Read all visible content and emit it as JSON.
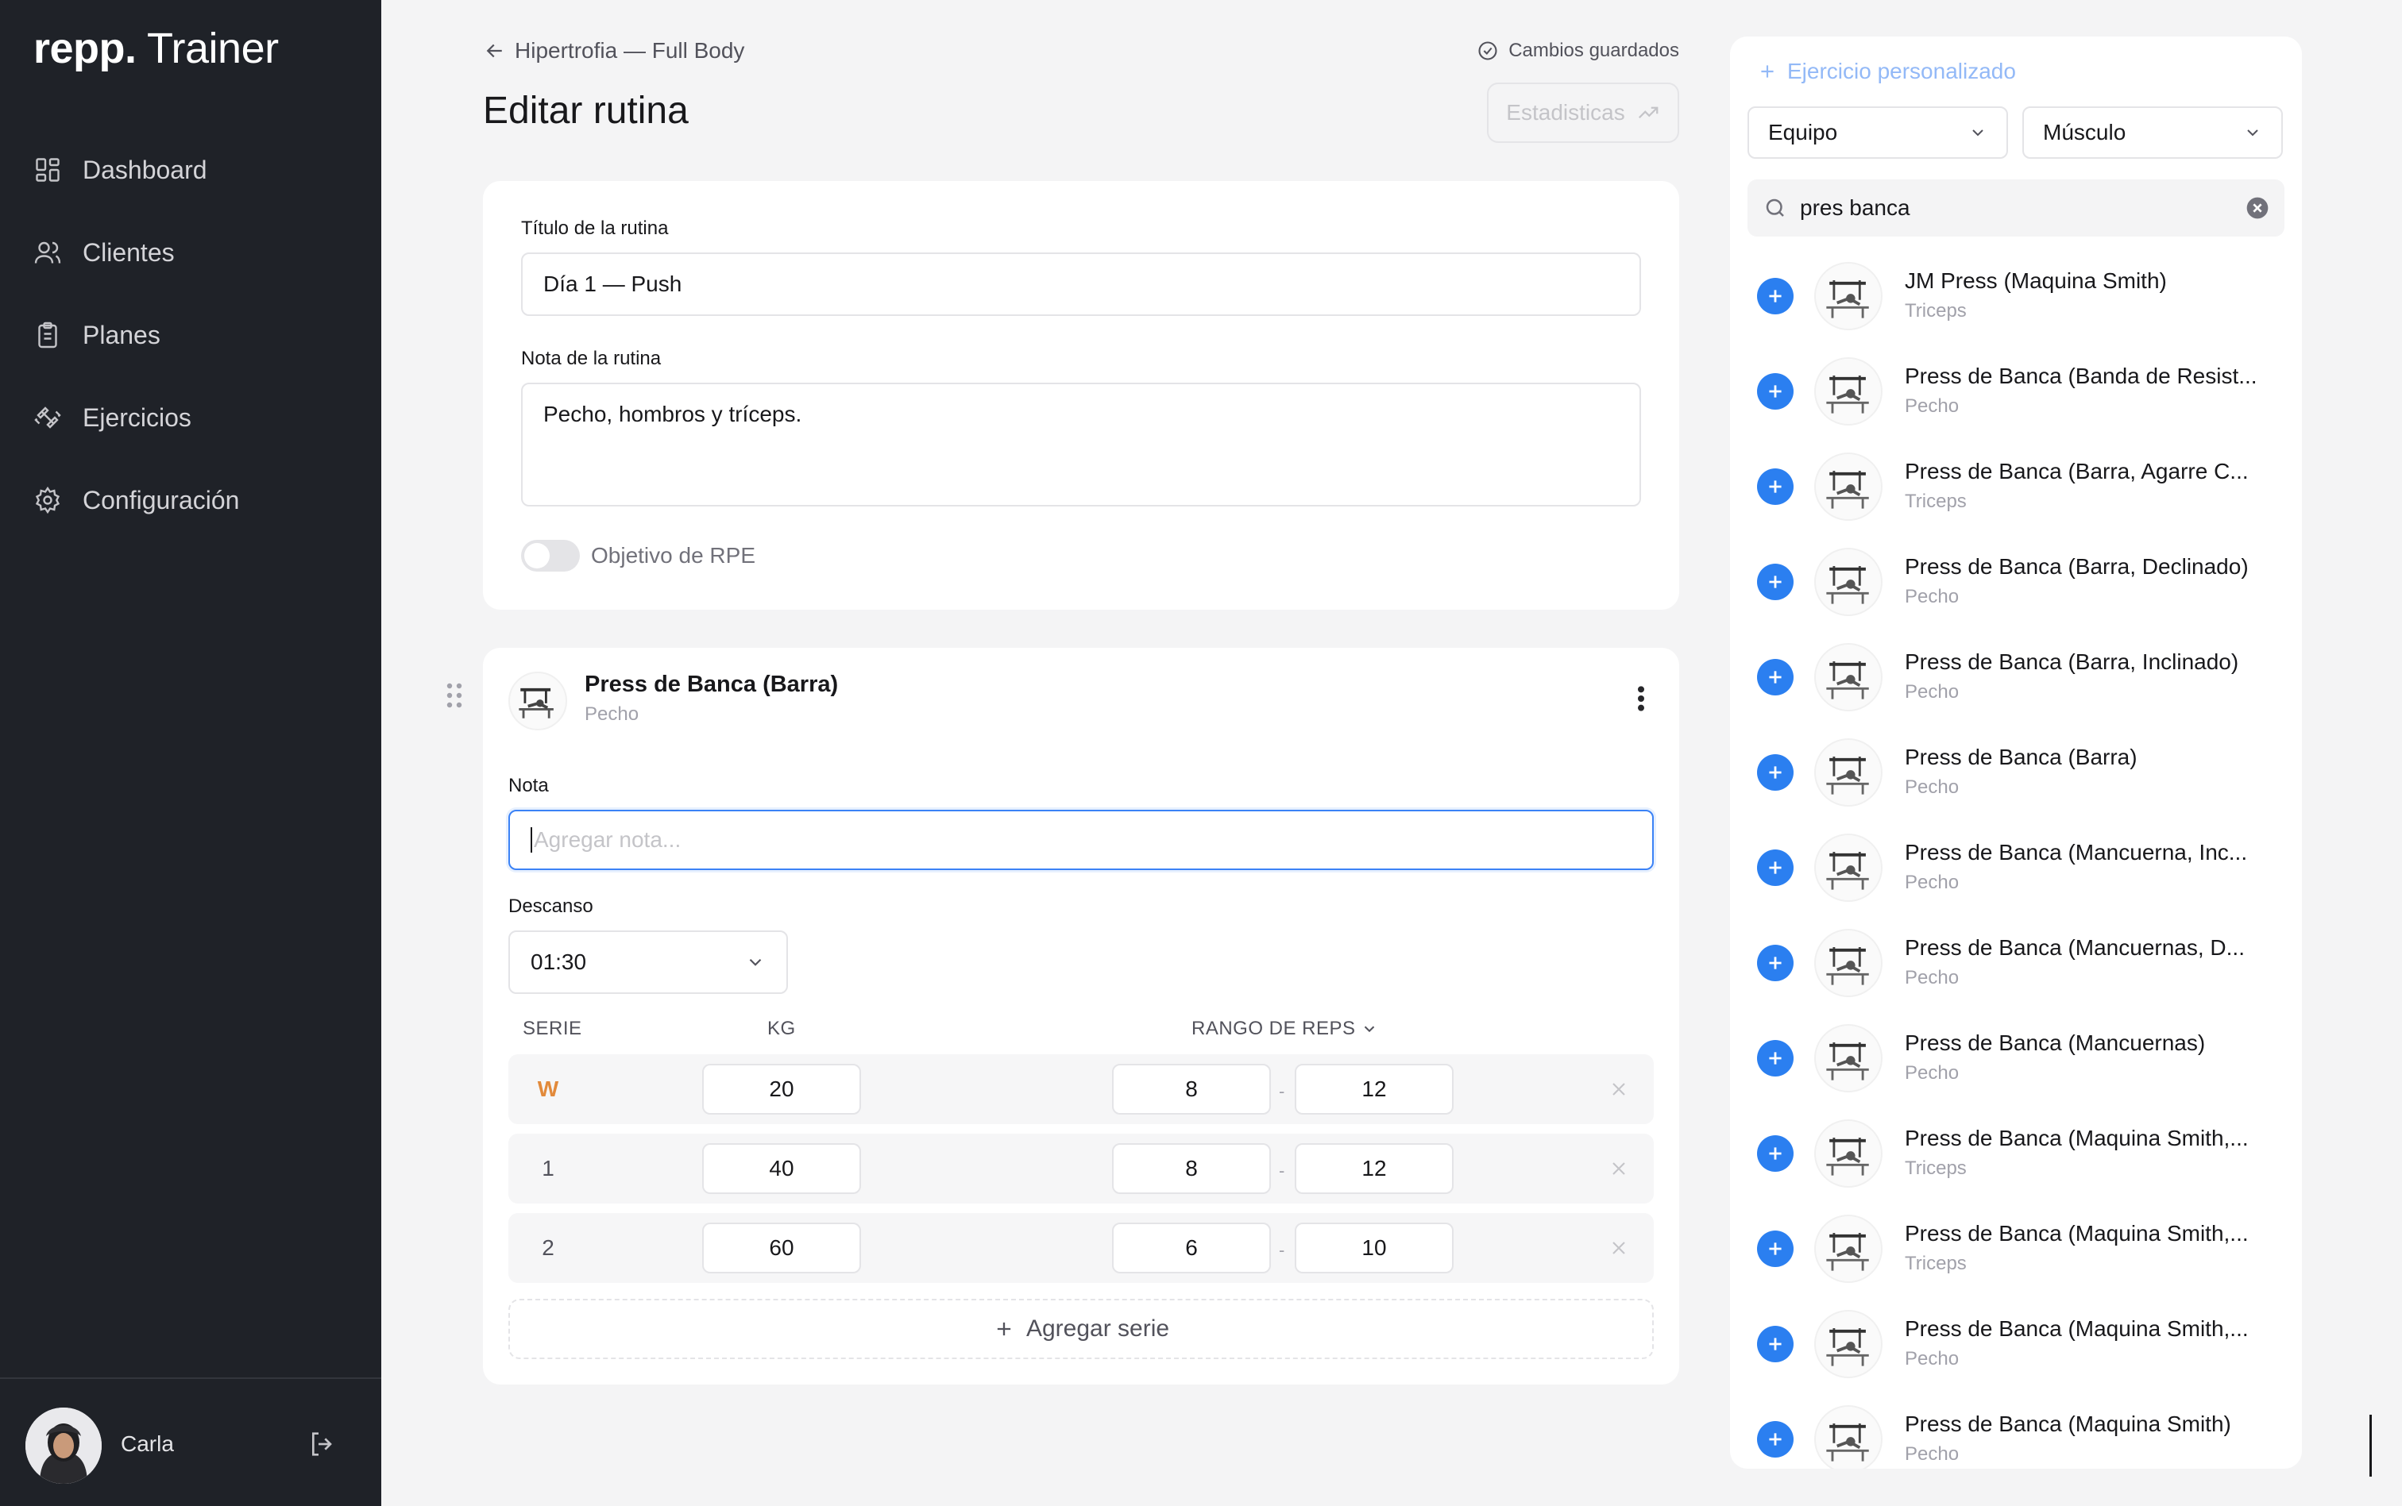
{
  "app": {
    "logo_bold": "repp.",
    "logo_light": " Trainer"
  },
  "sidebar": {
    "items": [
      {
        "label": "Dashboard",
        "icon": "dashboard-icon"
      },
      {
        "label": "Clientes",
        "icon": "users-icon"
      },
      {
        "label": "Planes",
        "icon": "clipboard-icon"
      },
      {
        "label": "Ejercicios",
        "icon": "dumbbell-icon"
      },
      {
        "label": "Configuración",
        "icon": "gear-icon"
      }
    ],
    "user": {
      "name": "Carla"
    }
  },
  "header": {
    "back_label": "Hipertrofia — Full Body",
    "saved_label": "Cambios guardados",
    "title": "Editar rutina",
    "stats_label": "Estadisticas"
  },
  "routine": {
    "title_label": "Título de la rutina",
    "title_value": "Día 1 — Push",
    "note_label": "Nota de la rutina",
    "note_value": "Pecho, hombros y tríceps.",
    "rpe_label": "Objetivo de RPE",
    "rpe_enabled": false
  },
  "exercise": {
    "name": "Press de Banca (Barra)",
    "muscle": "Pecho",
    "note_label": "Nota",
    "note_placeholder": "Agregar nota...",
    "rest_label": "Descanso",
    "rest_value": "01:30",
    "columns": {
      "set": "SERIE",
      "kg": "KG",
      "reps": "RANGO DE REPS"
    },
    "sets": [
      {
        "label": "W",
        "kg": "20",
        "reps_min": "8",
        "reps_max": "12",
        "warmup": true
      },
      {
        "label": "1",
        "kg": "40",
        "reps_min": "8",
        "reps_max": "12",
        "warmup": false
      },
      {
        "label": "2",
        "kg": "60",
        "reps_min": "6",
        "reps_max": "10",
        "warmup": false
      }
    ],
    "separator": "-",
    "add_set_label": "Agregar serie"
  },
  "panel": {
    "custom_label": "Ejercicio personalizado",
    "filter_equipment": "Equipo",
    "filter_muscle": "Músculo",
    "search_value": "pres banca",
    "results": [
      {
        "name": "JM Press (Maquina Smith)",
        "muscle": "Triceps"
      },
      {
        "name": "Press de Banca (Banda de Resist...",
        "muscle": "Pecho"
      },
      {
        "name": "Press de Banca (Barra, Agarre C...",
        "muscle": "Triceps"
      },
      {
        "name": "Press de Banca (Barra, Declinado)",
        "muscle": "Pecho"
      },
      {
        "name": "Press de Banca (Barra, Inclinado)",
        "muscle": "Pecho"
      },
      {
        "name": "Press de Banca (Barra)",
        "muscle": "Pecho"
      },
      {
        "name": "Press de Banca (Mancuerna, Inc...",
        "muscle": "Pecho"
      },
      {
        "name": "Press de Banca (Mancuernas, D...",
        "muscle": "Pecho"
      },
      {
        "name": "Press de Banca (Mancuernas)",
        "muscle": "Pecho"
      },
      {
        "name": "Press de Banca (Maquina Smith,...",
        "muscle": "Triceps"
      },
      {
        "name": "Press de Banca (Maquina Smith,...",
        "muscle": "Triceps"
      },
      {
        "name": "Press de Banca (Maquina Smith,...",
        "muscle": "Pecho"
      },
      {
        "name": "Press de Banca (Maquina Smith)",
        "muscle": "Pecho"
      }
    ]
  },
  "colors": {
    "sidebar_bg": "#1f2228",
    "accent": "#2b7ff0",
    "warmup": "#e28a3b"
  }
}
